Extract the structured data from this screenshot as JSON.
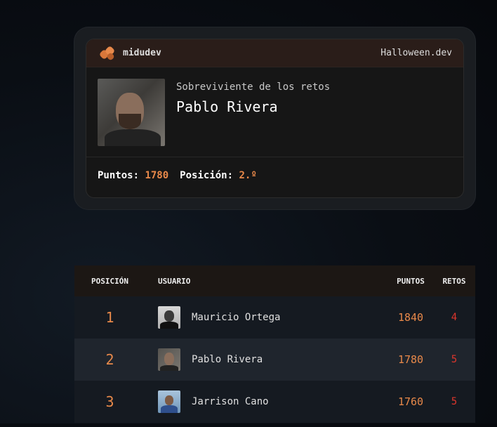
{
  "card": {
    "brand": "midudev",
    "event": "Halloween.dev",
    "subtitle": "Sobreviviente de los retos",
    "name": "Pablo Rivera",
    "points_label": "Puntos:",
    "points_value": "1780",
    "position_label": "Posición:",
    "position_value": "2.º"
  },
  "table": {
    "headers": {
      "position": "POSICIÓN",
      "user": "USUARIO",
      "points": "PUNTOS",
      "challenges": "RETOS"
    },
    "rows": [
      {
        "rank": "1",
        "name": "Mauricio Ortega",
        "points": "1840",
        "challenges": "4"
      },
      {
        "rank": "2",
        "name": "Pablo Rivera",
        "points": "1780",
        "challenges": "5"
      },
      {
        "rank": "3",
        "name": "Jarrison Cano",
        "points": "1760",
        "challenges": "5"
      }
    ]
  },
  "colors": {
    "accent": "#e8894a",
    "challenges": "#e0362c",
    "header_bg": "#2a1d19"
  }
}
